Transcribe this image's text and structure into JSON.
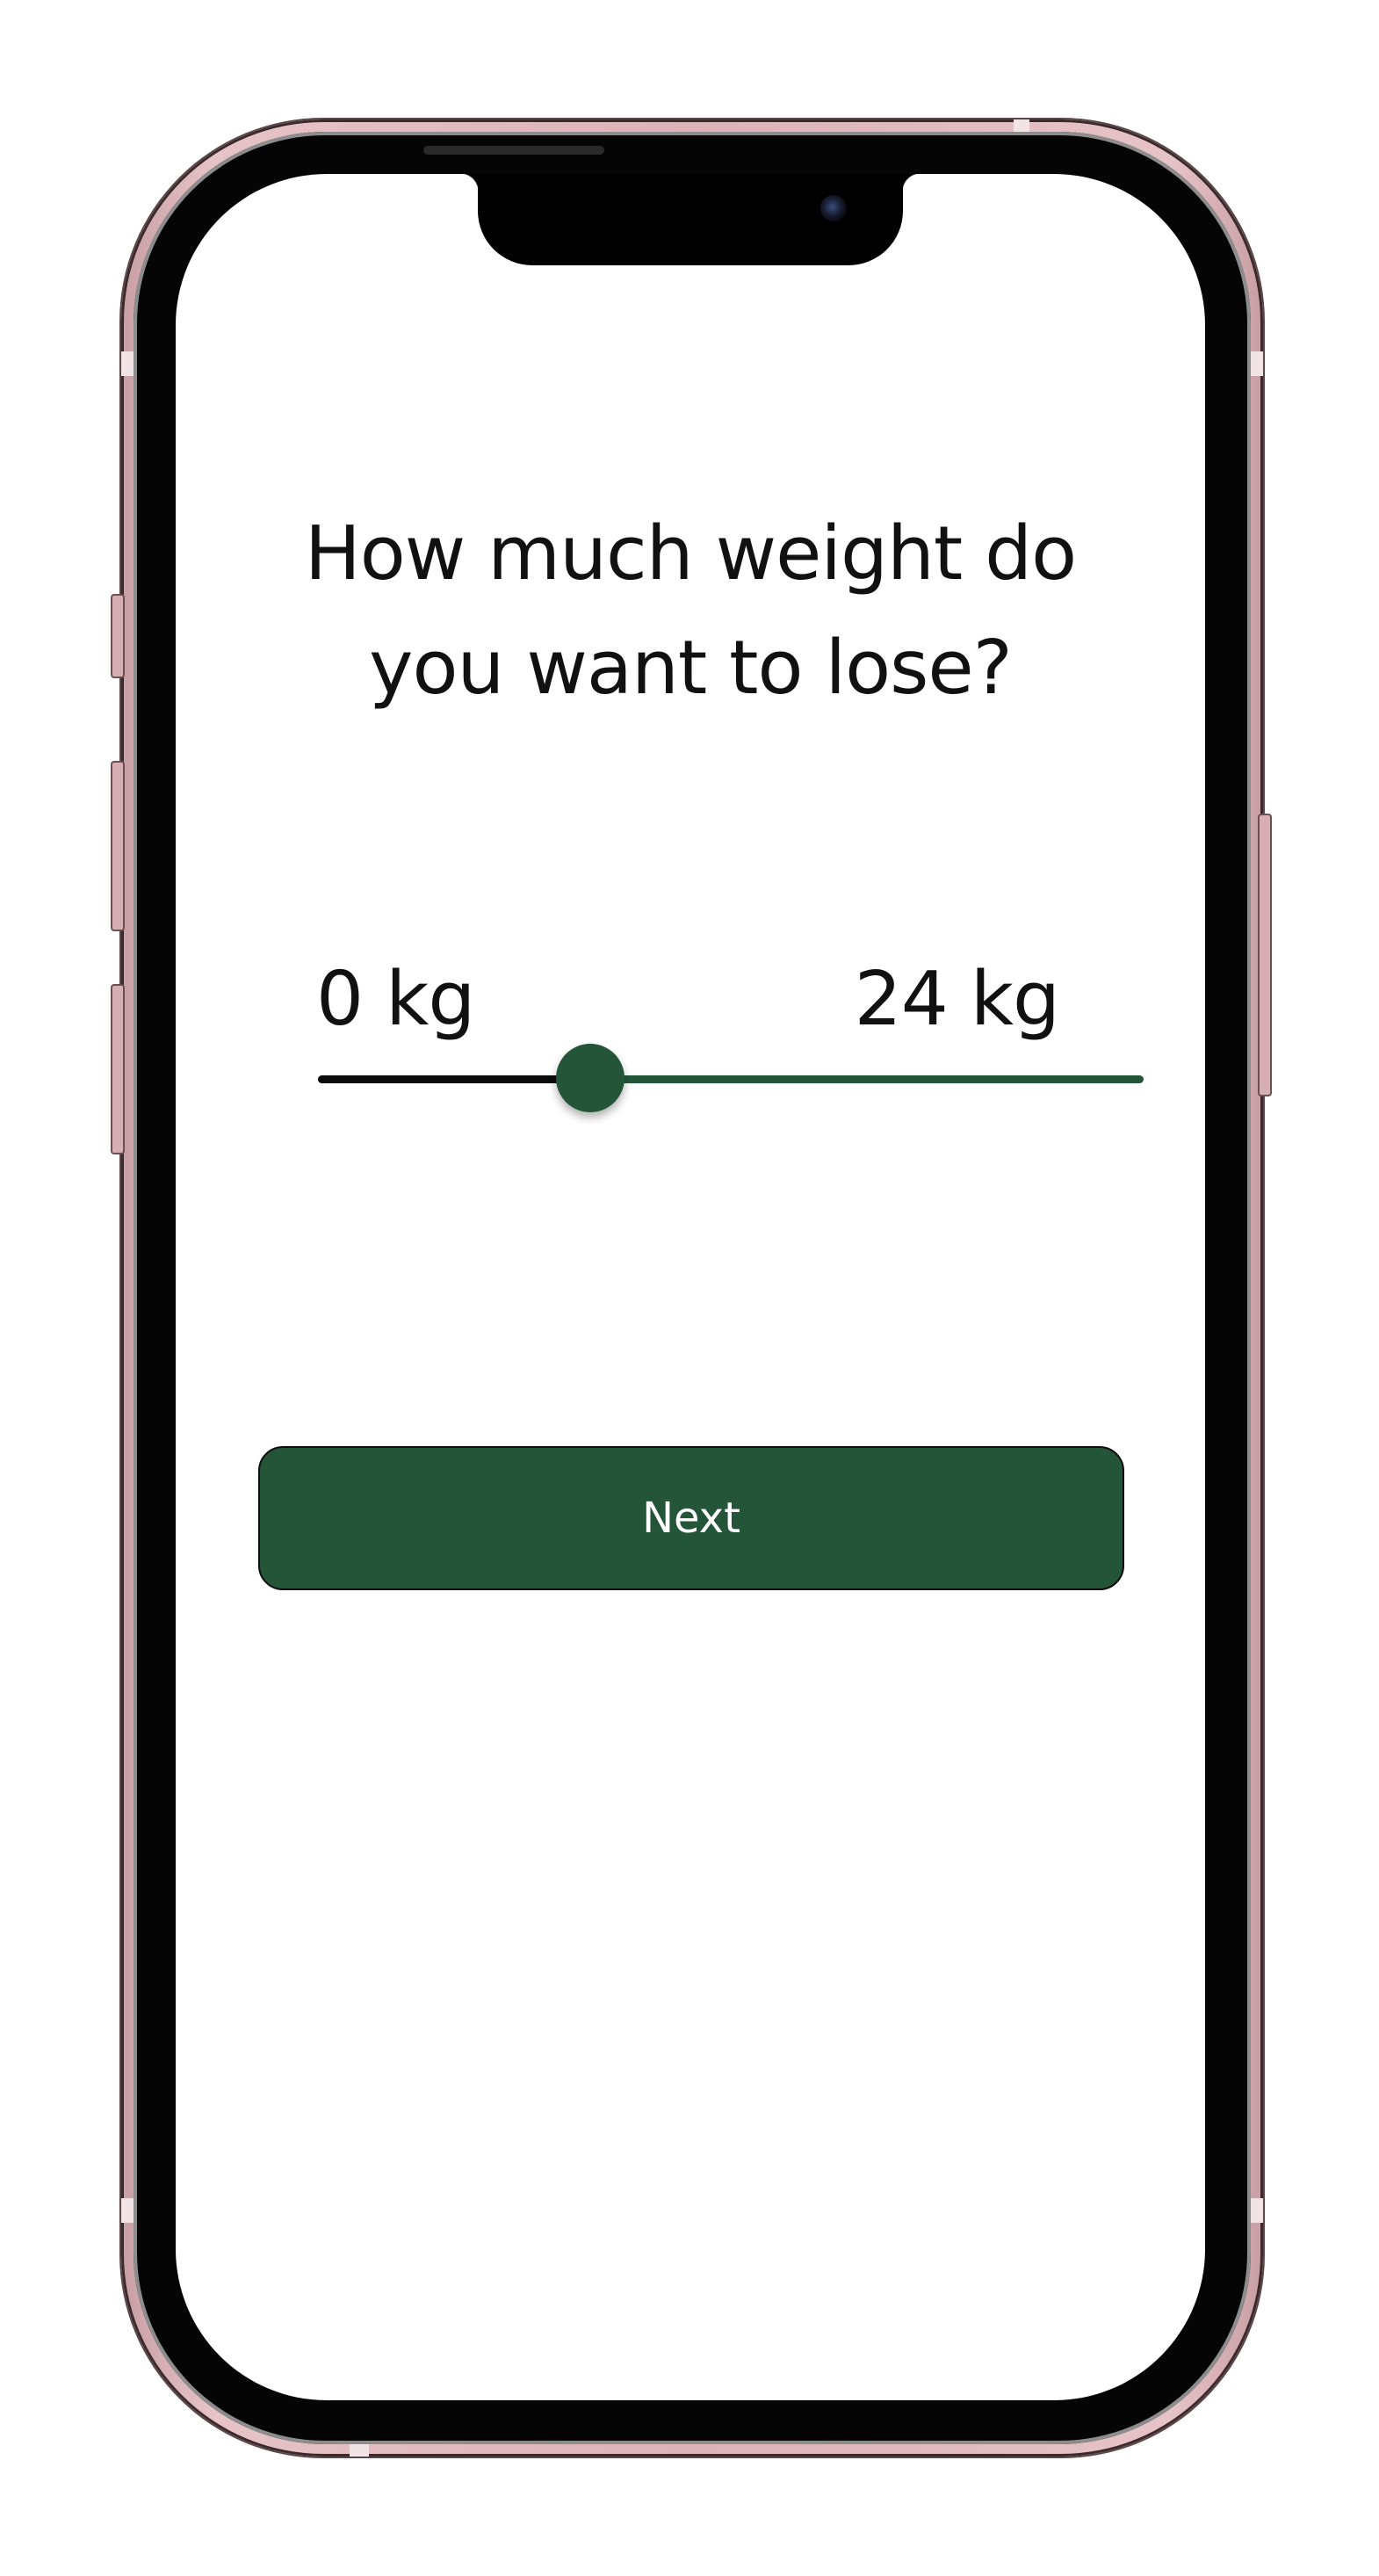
{
  "question": {
    "line1": "How much weight do",
    "line2": "you want to lose?"
  },
  "slider": {
    "min_label": "0 kg",
    "max_label": "24 kg",
    "min_value": 0,
    "max_value": 24,
    "unit": "kg",
    "value_fraction": 0.33,
    "colors": {
      "filled_track": "#0b0b0b",
      "remaining_track": "#245539",
      "thumb": "#245539"
    }
  },
  "actions": {
    "next_label": "Next",
    "button_color": "#245539"
  }
}
